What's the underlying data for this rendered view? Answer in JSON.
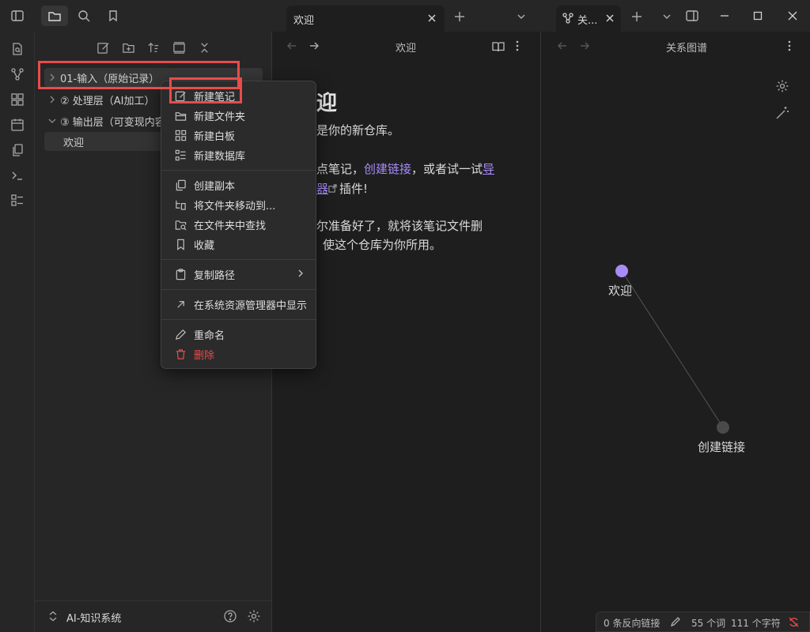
{
  "topbar": {
    "tabs": [
      {
        "label": "欢迎"
      },
      {
        "label": "关..."
      }
    ]
  },
  "sidebar": {
    "tree": [
      {
        "label": "01-输入（原始记录）"
      },
      {
        "label": "② 处理层（AI加工）"
      },
      {
        "label": "③ 输出层（可变现内容"
      },
      {
        "label": "欢迎"
      }
    ],
    "vault_name": "AI-知识系统"
  },
  "context_menu": {
    "items": [
      {
        "label": "新建笔记"
      },
      {
        "label": "新建文件夹"
      },
      {
        "label": "新建白板"
      },
      {
        "label": "新建数据库"
      },
      {
        "label": "创建副本"
      },
      {
        "label": "将文件夹移动到..."
      },
      {
        "label": "在文件夹中查找"
      },
      {
        "label": "收藏"
      },
      {
        "label": "复制路径"
      },
      {
        "label": "在系统资源管理器中显示"
      },
      {
        "label": "重命名"
      },
      {
        "label": "删除"
      }
    ],
    "danger_color": "#e84c4c"
  },
  "editor": {
    "header_title": "欢迎",
    "heading": "迎",
    "lines": {
      "l1": "是你的新仓库。",
      "l2_a": "点笔记，",
      "l2_link": "创建链接",
      "l2_b": "，或者试一试",
      "l2_link2": "导",
      "l3_link": "器",
      "l3_b": "插件!",
      "l4": "尔准备好了，就将该笔记文件删",
      "l5": "使这个仓库为你所用。"
    }
  },
  "graph": {
    "header_title": "关系图谱",
    "nodes": [
      {
        "label": "欢迎",
        "color": "#a88bfa"
      },
      {
        "label": "创建链接",
        "color": "#555555"
      }
    ]
  },
  "status_bar": {
    "backlinks": "0 条反向链接",
    "words": "55 个词",
    "chars": "111 个字符"
  },
  "highlight_color": "#e84c4c"
}
